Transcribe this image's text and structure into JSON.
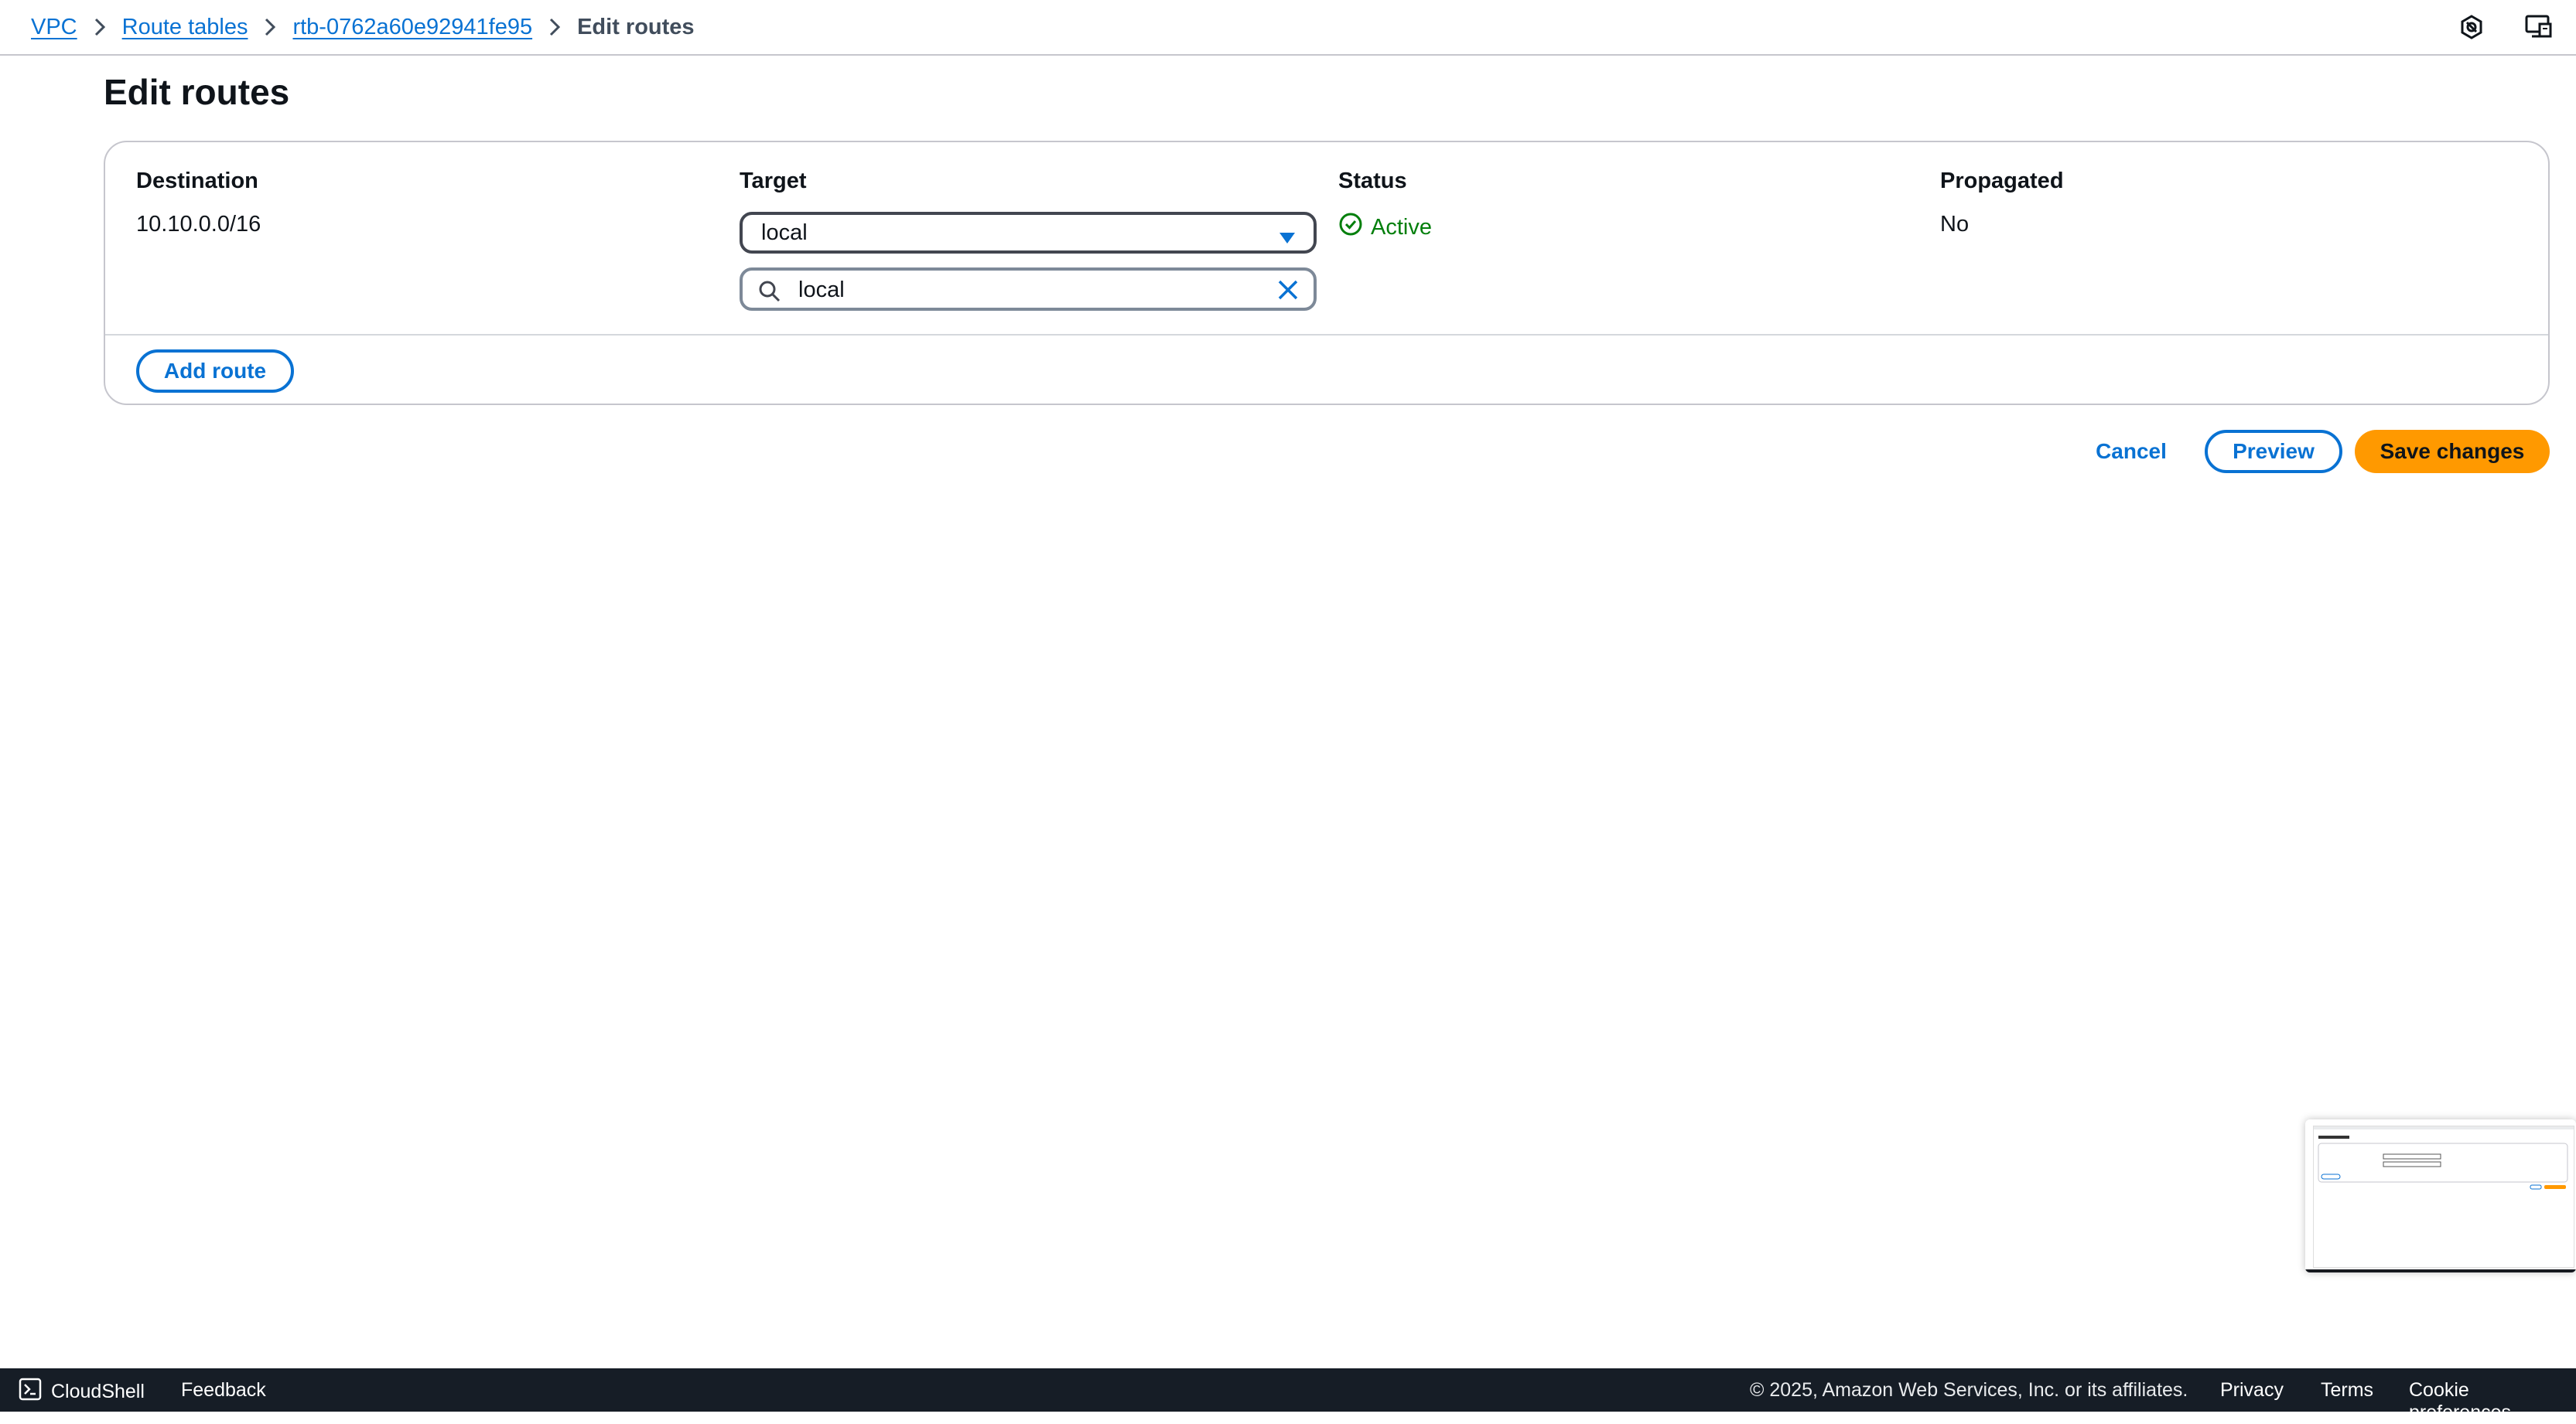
{
  "breadcrumb": {
    "items": [
      {
        "label": "VPC"
      },
      {
        "label": "Route tables"
      },
      {
        "label": "rtb-0762a60e92941fe95"
      }
    ],
    "current": "Edit routes"
  },
  "header_icons": [
    "settings-hexagon-icon",
    "remote-desktop-icon"
  ],
  "page": {
    "title": "Edit routes"
  },
  "routes": {
    "columns": {
      "destination": "Destination",
      "target": "Target",
      "status": "Status",
      "propagated": "Propagated"
    },
    "rows": [
      {
        "destination": "10.10.0.0/16",
        "target": "local",
        "target_search_value": "local",
        "status": "Active",
        "propagated": "No"
      }
    ],
    "add_route_label": "Add route"
  },
  "actions": {
    "cancel": "Cancel",
    "preview": "Preview",
    "save": "Save changes"
  },
  "footer": {
    "cloudshell": "CloudShell",
    "feedback": "Feedback",
    "copyright": "© 2025, Amazon Web Services, Inc. or its affiliates.",
    "privacy": "Privacy",
    "terms": "Terms",
    "cookies": "Cookie preferences"
  },
  "colors": {
    "link": "#0972d3",
    "primary_button": "#ff9900",
    "status_success": "#037f0c",
    "footer_bg": "#161d26"
  }
}
